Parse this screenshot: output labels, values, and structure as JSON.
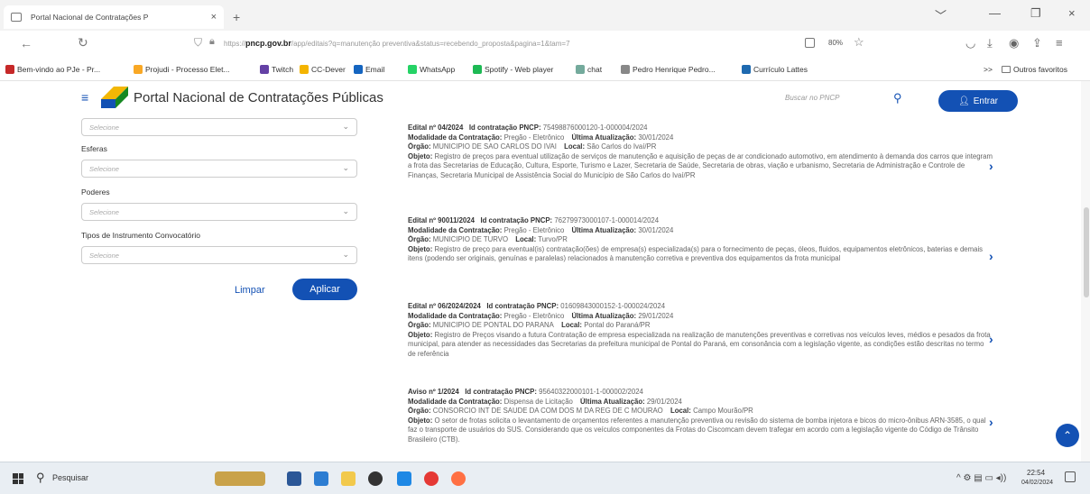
{
  "browser": {
    "tab_title": "Portal Nacional de Contratações P",
    "tab_close": "×",
    "new_tab": "+",
    "url_prefix": "https://",
    "url_domain": "pncp.gov.br",
    "url_path": "/app/editais?q=manutenção preventiva&status=recebendo_proposta&pagina=1&tam=7",
    "zoom": "80%",
    "window_controls": [
      "﹀",
      "—",
      "❐",
      "×"
    ]
  },
  "bookmarks": [
    {
      "label": "Bem-vindo ao PJe - Pr...",
      "color": "#c62828"
    },
    {
      "label": "Projudi - Processo Elet...",
      "color": "#f9a825"
    },
    {
      "label": "Twitch",
      "color": "#6441a5"
    },
    {
      "label": "CC-Dever",
      "color": "#f4b400"
    },
    {
      "label": "Email",
      "color": "#1565c0"
    },
    {
      "label": "WhatsApp",
      "color": "#25d366"
    },
    {
      "label": "Spotify - Web player",
      "color": "#1db954"
    },
    {
      "label": "chat",
      "color": "#74aa9c"
    },
    {
      "label": "Pedro Henrique Pedro...",
      "color": "#888888"
    },
    {
      "label": "Currículo Lattes",
      "color": "#1e6ab0"
    }
  ],
  "bookmarks_overflow": ">>",
  "other_favorites": "Outros favoritos",
  "header": {
    "title": "Portal Nacional de Contratações Públicas",
    "search_placeholder": "Buscar no PNCP",
    "login_label": "Entrar"
  },
  "filters": {
    "first_select": "Selecione",
    "groups": [
      {
        "label": "Esferas",
        "placeholder": "Selecione"
      },
      {
        "label": "Poderes",
        "placeholder": "Selecione"
      },
      {
        "label": "Tipos de Instrumento Convocatório",
        "placeholder": "Selecione"
      }
    ],
    "clear_label": "Limpar",
    "apply_label": "Aplicar"
  },
  "labels": {
    "id": "Id contratação PNCP:",
    "modalidade": "Modalidade da Contratação:",
    "atualizacao": "Última Atualização:",
    "orgao": "Órgão:",
    "local": "Local:",
    "objeto": "Objeto:"
  },
  "results": [
    {
      "edital": "Edital nº 04/2024",
      "id": "75498876000120-1-000004/2024",
      "modalidade": "Pregão - Eletrônico",
      "atualizacao": "30/01/2024",
      "orgao": "MUNICIPIO DE SAO CARLOS DO IVAI",
      "local": "São Carlos do Ivaí/PR",
      "objeto": "Registro de preços para eventual utilização de serviços de manutenção e aquisição de peças de ar condicionado automotivo, em atendimento à demanda dos carros que integram a frota das Secretarias de Educação, Cultura, Esporte, Turismo e Lazer, Secretaria de Saúde, Secretaria de obras, viação e urbanismo, Secretaria de Administração e Controle de Finanças, Secretaria Municipal de Assistência Social do Município de São Carlos do Ivaí/PR"
    },
    {
      "edital": "Edital nº 90011/2024",
      "id": "76279973000107-1-000014/2024",
      "modalidade": "Pregão - Eletrônico",
      "atualizacao": "30/01/2024",
      "orgao": "MUNICIPIO DE TURVO",
      "local": "Turvo/PR",
      "objeto": "Registro de preço para eventual(is) contratação(ões) de empresa(s) especializada(s) para o fornecimento de peças, óleos, fluidos, equipamentos eletrônicos, baterias e demais itens (podendo ser originais, genuínas e paralelas) relacionados à manutenção corretiva e preventiva dos equipamentos da frota municipal"
    },
    {
      "edital": "Edital nº 06/2024/2024",
      "id": "01609843000152-1-000024/2024",
      "modalidade": "Pregão - Eletrônico",
      "atualizacao": "29/01/2024",
      "orgao": "MUNICIPIO DE PONTAL DO PARANA",
      "local": "Pontal do Paraná/PR",
      "objeto": "Registro de Preços visando a futura Contratação de empresa especializada na realização de manutenções preventivas e corretivas nos veículos leves, médios e pesados da frota municipal, para atender as necessidades das Secretarias da prefeitura municipal de Pontal do Paraná, em consonância com a legislação vigente, as condições estão descritas no termo de referência"
    },
    {
      "edital": "Aviso nº 1/2024",
      "id": "95640322000101-1-000002/2024",
      "modalidade": "Dispensa de Licitação",
      "atualizacao": "29/01/2024",
      "orgao": "CONSORCIO INT DE SAUDE DA COM DOS M DA REG DE C MOURAO",
      "local": "Campo Mourão/PR",
      "objeto": "O setor de frotas solicita o levantamento de orçamentos referentes a manutenção preventiva ou revisão do sistema de bomba injetora e bicos do micro-ônibus ARN-3585, o qual faz o transporte de usuários do SUS. Considerando que os veículos componentes da Frotas do Ciscomcam devem trafegar em acordo com a legislação vigente do Código de Trânsito Brasileiro (CTB)."
    }
  ],
  "taskbar": {
    "search_label": "Pesquisar",
    "apps": [
      {
        "name": "widgets-icon",
        "color": "#c9a24a"
      },
      {
        "name": "word-icon",
        "color": "#2b5797"
      },
      {
        "name": "store-icon",
        "color": "#2d7dd2"
      },
      {
        "name": "explorer-icon",
        "color": "#f2c94c"
      },
      {
        "name": "obs-icon",
        "color": "#333333"
      },
      {
        "name": "vscode-icon",
        "color": "#1e88e5"
      },
      {
        "name": "opera-icon",
        "color": "#e53935"
      },
      {
        "name": "firefox-icon",
        "color": "#ff7043"
      }
    ],
    "time": "22:54",
    "date": "04/02/2024"
  }
}
